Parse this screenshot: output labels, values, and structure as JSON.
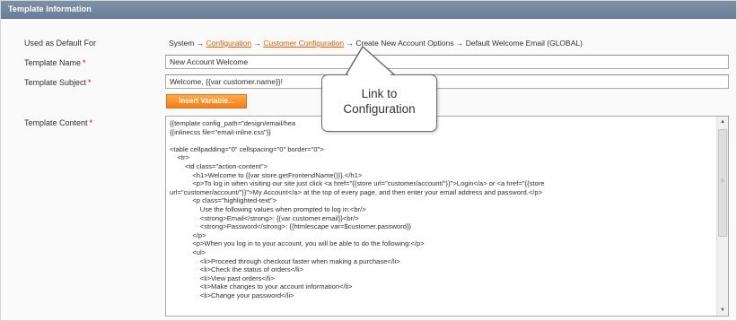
{
  "panel": {
    "title": "Template Information"
  },
  "fields": {
    "used_as_default": {
      "label": "Used as Default For",
      "path_prefix": "System → ",
      "link1": "Configuration",
      "sep1": " → ",
      "link2": "Customer Configuration",
      "path_suffix": " → Create New Account Options → Default Welcome Email  (GLOBAL)"
    },
    "template_name": {
      "label": "Template Name",
      "required_mark": "*",
      "value": "New Account Welcome"
    },
    "template_subject": {
      "label": "Template Subject",
      "required_mark": "*",
      "value": "Welcome, {{var customer.name}}!"
    },
    "insert_variable_button": "Insert Variable...",
    "template_content": {
      "label": "Template Content",
      "required_mark": "*",
      "lines": [
        "{{template config_path=\"design/email/hea",
        "{{inlinecss file=\"email-inline.css\"}}",
        "",
        "<table cellpadding=\"0\" cellspacing=\"0\" border=\"0\">",
        "    <tr>",
        "        <td class=\"action-content\">",
        "            <h1>Welcome to {{var store.getFrontendName()}}.</h1>",
        "            <p>To log in when visiting our site just click <a href=\"{{store url=\"customer/account/\"}}\">Login</a> or <a href=\"{{store",
        "url=\"customer/account/\"}}\">My Account</a> at the top of every page, and then enter your email address and password.</p>",
        "            <p class=\"highlighted-text\">",
        "                Use the following values when prompted to log in:<br/>",
        "                <strong>Email</strong>: {{var customer.email}}<br/>",
        "                <strong>Password</strong>: {{htmlescape var=$customer.password}}",
        "            </p>",
        "            <p>When you log in to your account, you will be able to do the following:</p>",
        "            <ul>",
        "                <li>Proceed through checkout faster when making a purchase</li>",
        "                <li>Check the status of orders</li>",
        "                <li>View past orders</li>",
        "                <li>Make changes to your account information</li>",
        "                <li>Change your password</li>"
      ]
    }
  },
  "callout": {
    "line1": "Link to",
    "line2": "Configuration"
  },
  "colors": {
    "header": "#6a7f97",
    "link": "#eb5e00",
    "button": "#f77c16",
    "required": "#d40707"
  }
}
